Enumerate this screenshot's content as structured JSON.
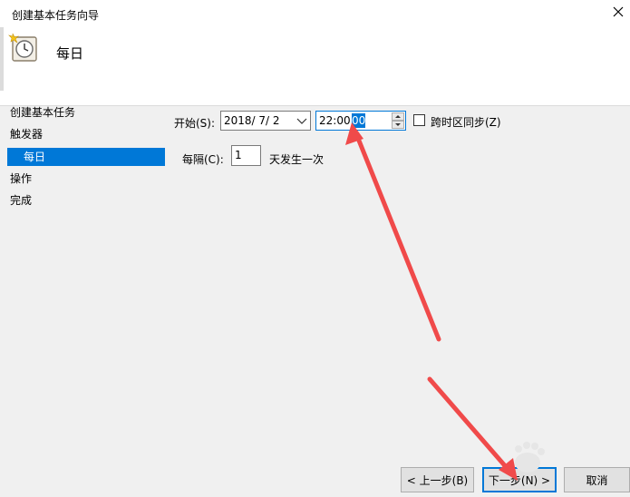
{
  "window": {
    "title": "创建基本任务向导"
  },
  "header": {
    "title": "每日"
  },
  "sidebar": {
    "steps": [
      {
        "label": "创建基本任务"
      },
      {
        "label": "触发器"
      },
      {
        "label": "每日"
      },
      {
        "label": "操作"
      },
      {
        "label": "完成"
      }
    ]
  },
  "form": {
    "start_label": "开始(S):",
    "start_date": "2018/  7/  2",
    "start_time_hm": "22:00:",
    "start_time_sec": "00",
    "sync_timezones_label": "跨时区同步(Z)",
    "sync_timezones_checked": false,
    "recur_label": "每隔(C):",
    "recur_value": "1",
    "recur_suffix": "天发生一次"
  },
  "buttons": {
    "back": "< 上一步(B)",
    "next": "下一步(N) >",
    "cancel": "取消"
  },
  "colors": {
    "accent": "#0078d7",
    "annotation_arrow": "#f04a4a"
  }
}
